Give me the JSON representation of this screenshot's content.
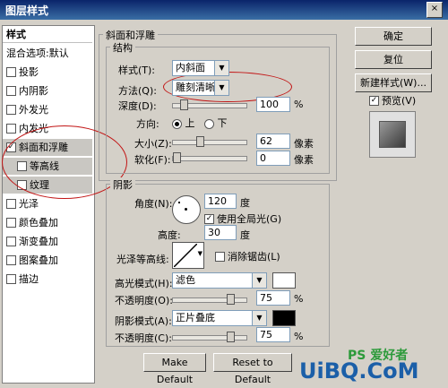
{
  "window": {
    "title": "图层样式",
    "close_glyph": "×"
  },
  "sidebar": {
    "header": "样式",
    "items": [
      {
        "label": "混合选项:默认",
        "checkbox": false,
        "checked": false
      },
      {
        "label": "投影",
        "checkbox": true,
        "checked": false
      },
      {
        "label": "内阴影",
        "checkbox": true,
        "checked": false
      },
      {
        "label": "外发光",
        "checkbox": true,
        "checked": false
      },
      {
        "label": "内发光",
        "checkbox": true,
        "checked": false
      },
      {
        "label": "斜面和浮雕",
        "checkbox": true,
        "checked": true
      },
      {
        "label": "等高线",
        "checkbox": true,
        "checked": false
      },
      {
        "label": "纹理",
        "checkbox": true,
        "checked": false
      },
      {
        "label": "光泽",
        "checkbox": true,
        "checked": false
      },
      {
        "label": "颜色叠加",
        "checkbox": true,
        "checked": false
      },
      {
        "label": "渐变叠加",
        "checkbox": true,
        "checked": false
      },
      {
        "label": "图案叠加",
        "checkbox": true,
        "checked": false
      },
      {
        "label": "描边",
        "checkbox": true,
        "checked": false
      }
    ]
  },
  "bevel": {
    "section_title": "斜面和浮雕",
    "structure_title": "结构",
    "style_label": "样式(T):",
    "style_value": "内斜面",
    "technique_label": "方法(Q):",
    "technique_value": "雕刻清晰",
    "depth_label": "深度(D):",
    "depth_value": "100",
    "depth_unit": "%",
    "direction_label": "方向:",
    "direction_up": "上",
    "direction_down": "下",
    "size_label": "大小(Z):",
    "size_value": "62",
    "size_unit": "像素",
    "soften_label": "软化(F):",
    "soften_value": "0",
    "soften_unit": "像素"
  },
  "shading": {
    "title": "阴影",
    "angle_label": "角度(N):",
    "angle_value": "120",
    "angle_unit": "度",
    "global_light_label": "使用全局光(G)",
    "altitude_label": "高度:",
    "altitude_value": "30",
    "altitude_unit": "度",
    "gloss_contour_label": "光泽等高线:",
    "antialias_label": "消除锯齿(L)",
    "highlight_mode_label": "高光模式(H):",
    "highlight_mode_value": "滤色",
    "highlight_opacity_label": "不透明度(O):",
    "highlight_opacity_value": "75",
    "highlight_opacity_unit": "%",
    "highlight_color": "#ffffff",
    "shadow_mode_label": "阴影模式(A):",
    "shadow_mode_value": "正片叠底",
    "shadow_opacity_label": "不透明度(C):",
    "shadow_opacity_value": "75",
    "shadow_opacity_unit": "%",
    "shadow_color": "#000000"
  },
  "buttons": {
    "make_default": "Make Default",
    "reset_default": "Reset to Default",
    "ok": "确定",
    "reset": "复位",
    "new_style": "新建样式(W)...",
    "preview": "预览(V)"
  },
  "watermark": {
    "text": "UiBQ.CoM",
    "logo": "PS 爱好者"
  }
}
